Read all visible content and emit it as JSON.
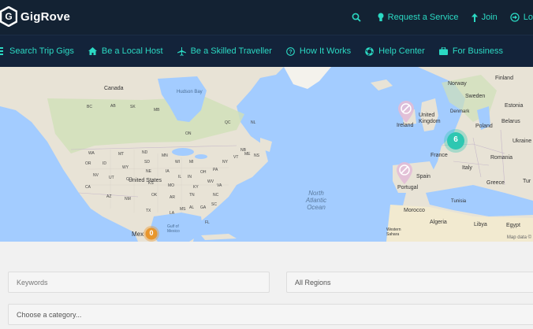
{
  "header": {
    "brand": "GigRove",
    "actions": [
      {
        "label": "",
        "icon": "search-icon"
      },
      {
        "label": "Request a Service",
        "icon": "lightbulb-icon"
      },
      {
        "label": "Join",
        "icon": "arrow-up-icon"
      },
      {
        "label": "Lo",
        "icon": "login-icon"
      }
    ]
  },
  "nav": {
    "items": [
      {
        "label": "Search Trip Gigs",
        "icon": "list-icon"
      },
      {
        "label": "Be a Local Host",
        "icon": "home-icon"
      },
      {
        "label": "Be a Skilled Traveller",
        "icon": "plane-icon"
      },
      {
        "label": "How It Works",
        "icon": "question-circle-icon"
      },
      {
        "label": "Help Center",
        "icon": "lifebuoy-icon"
      },
      {
        "label": "For Business",
        "icon": "briefcase-icon"
      }
    ]
  },
  "map": {
    "cluster_count": "6",
    "cluster_mexico": "0",
    "ocean_label": "North Atlantic Ocean",
    "gulf_label": "Gulf of Mexico",
    "hudson_label": "Hudson Bay",
    "attribution": "Map data ©",
    "labels": {
      "canada": "Canada",
      "united_states": "United States",
      "mexico": "Mex",
      "greenland_sea": "",
      "norway": "Norway",
      "finland": "Finland",
      "sweden": "Sweden",
      "estonia": "Estonia",
      "denmark": "Denmark",
      "united_kingdom": "United Kingdom",
      "ireland": "Ireland",
      "poland": "Poland",
      "belarus": "Belarus",
      "ukraine": "Ukraine",
      "france": "France",
      "italy": "Italy",
      "romania": "Romania",
      "spain": "Spain",
      "portugal": "Portugal",
      "greece": "Greece",
      "turkey": "Tur",
      "morocco": "Morocco",
      "tunisia": "Tunisia",
      "algeria": "Algeria",
      "libya": "Libya",
      "egypt": "Egypt",
      "western_sahara": "Western Sahara"
    },
    "state_codes": [
      "BC",
      "AB",
      "SK",
      "MB",
      "ON",
      "QC",
      "NL",
      "NB",
      "NS",
      "WA",
      "MT",
      "ND",
      "MN",
      "WI",
      "MI",
      "OR",
      "ID",
      "WY",
      "SD",
      "IA",
      "IL",
      "IN",
      "OH",
      "PA",
      "NY",
      "VT",
      "ME",
      "NV",
      "UT",
      "CO",
      "NE",
      "KS",
      "MO",
      "KY",
      "WV",
      "VA",
      "CA",
      "AZ",
      "NM",
      "OK",
      "AR",
      "TN",
      "NC",
      "SC",
      "TX",
      "LA",
      "MS",
      "AL",
      "GA",
      "FL"
    ]
  },
  "form": {
    "keywords_placeholder": "Keywords",
    "regions_value": "All Regions",
    "category_placeholder": "Choose a category..."
  },
  "colors": {
    "brand_teal": "#2bd9c3",
    "header_bg": "#132233",
    "water": "#a3ccff",
    "land": "#e8e3d6",
    "cluster_teal": "#2ec7b1",
    "cluster_orange": "#e8962c"
  }
}
